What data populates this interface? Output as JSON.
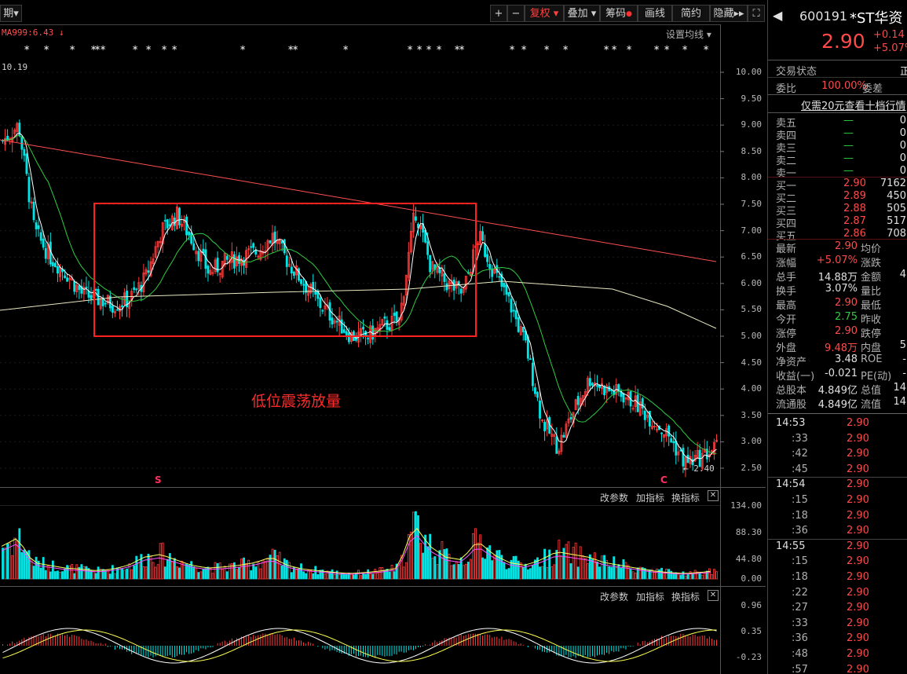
{
  "toolbar": {
    "period_label": "期",
    "plus": "+",
    "minus": "−",
    "fuquan": "复权",
    "diejia": "叠加",
    "chouma": "筹码",
    "huaxian": "画线",
    "jianyue": "简约",
    "yincang": "隐藏",
    "expand": "⛶"
  },
  "chart": {
    "ma_label": "MA999:6.43",
    "ma_arrow": "↓",
    "settings_label": "设置均线",
    "high_label": "10.19",
    "low_label": "2.40",
    "s_marker": "S",
    "c_marker": "C",
    "annotation": "低位震荡放量",
    "price_axis": [
      "10.00",
      "9.50",
      "9.00",
      "8.50",
      "8.00",
      "7.50",
      "7.00",
      "6.50",
      "6.00",
      "5.50",
      "5.00",
      "4.50",
      "4.00",
      "3.50",
      "3.00",
      "2.50"
    ],
    "volume_axis": [
      "134.00",
      "88.30",
      "44.80",
      "0.00"
    ],
    "macd_axis": [
      "0.96",
      "0.35",
      "-0.23"
    ],
    "vol_links": {
      "params": "改参数",
      "add": "加指标",
      "switch": "换指标"
    },
    "macd_links": {
      "params": "改参数",
      "add": "加指标",
      "switch": "换指标"
    },
    "colors": {
      "up": "#ff3b3b",
      "down": "#00e5e5",
      "ma_long": "#ff5050",
      "ma_slow": "#e8e8c0",
      "ma_mid": "#2ecc40",
      "ma_fast": "#ffffff",
      "box": "#ff2020"
    }
  },
  "chart_data": {
    "type": "candlestick",
    "price_range": [
      2.4,
      10.19
    ],
    "price_ticks": [
      10.0,
      9.5,
      9.0,
      8.5,
      8.0,
      7.5,
      7.0,
      6.5,
      6.0,
      5.5,
      5.0,
      4.5,
      4.0,
      3.5,
      3.0,
      2.5
    ],
    "volume_ticks": [
      134.0,
      88.3,
      44.8,
      0.0
    ],
    "macd_ticks": [
      0.96,
      0.35,
      -0.23
    ],
    "annotation": "低位震荡放量",
    "ma999_value": 6.43,
    "trend_close": [
      8.7,
      9.0,
      7.0,
      6.5,
      6.2,
      5.8,
      5.7,
      5.6,
      5.7,
      6.1,
      7.0,
      7.3,
      6.8,
      6.2,
      6.4,
      6.5,
      6.6,
      6.9,
      6.4,
      6.0,
      5.6,
      5.3,
      5.0,
      5.0,
      5.2,
      5.3,
      7.4,
      6.3,
      6.0,
      5.8,
      6.9,
      6.2,
      5.6,
      4.8,
      3.4,
      2.9,
      3.6,
      4.2,
      4.0,
      3.9,
      3.7,
      3.4,
      3.1,
      2.6,
      2.7,
      2.9
    ],
    "volume_profile": [
      60,
      75,
      30,
      25,
      20,
      18,
      15,
      18,
      25,
      40,
      45,
      35,
      25,
      20,
      22,
      25,
      30,
      40,
      25,
      18,
      15,
      12,
      10,
      12,
      15,
      20,
      100,
      60,
      40,
      35,
      70,
      45,
      30,
      25,
      35,
      50,
      45,
      40,
      30,
      25,
      20,
      15,
      12,
      10,
      12,
      15
    ]
  },
  "sidebar": {
    "code": "600191",
    "name": "*ST华资",
    "price": "2.90",
    "change": "+0.14",
    "change_pct": "+5.07%",
    "status_label": "交易状态",
    "status_val": "正",
    "weibi_label": "委比",
    "weibi_val": "100.00%",
    "weicha_label": "委差",
    "ad_text": "仅需20元查看十档行情",
    "sells": [
      {
        "label": "卖五",
        "price": "—",
        "vol": "0"
      },
      {
        "label": "卖四",
        "price": "—",
        "vol": "0"
      },
      {
        "label": "卖三",
        "price": "—",
        "vol": "0"
      },
      {
        "label": "卖二",
        "price": "—",
        "vol": "0"
      },
      {
        "label": "卖一",
        "price": "—",
        "vol": "0"
      }
    ],
    "buys": [
      {
        "label": "买一",
        "price": "2.90",
        "vol": "7162"
      },
      {
        "label": "买二",
        "price": "2.89",
        "vol": "450"
      },
      {
        "label": "买三",
        "price": "2.88",
        "vol": "505"
      },
      {
        "label": "买四",
        "price": "2.87",
        "vol": "517"
      },
      {
        "label": "买五",
        "price": "2.86",
        "vol": "708"
      }
    ],
    "stats": [
      {
        "l1": "最新",
        "v1": "2.90",
        "c1": "red",
        "l2": "均价",
        "v2": ""
      },
      {
        "l1": "涨幅",
        "v1": "+5.07%",
        "c1": "red",
        "l2": "涨跌",
        "v2": ""
      },
      {
        "l1": "总手",
        "v1": "14.88万",
        "c1": "white",
        "l2": "金额",
        "v2": "4"
      },
      {
        "l1": "换手",
        "v1": "3.07%",
        "c1": "white",
        "l2": "量比",
        "v2": ""
      },
      {
        "l1": "最高",
        "v1": "2.90",
        "c1": "red",
        "l2": "最低",
        "v2": ""
      },
      {
        "l1": "今开",
        "v1": "2.75",
        "c1": "green",
        "l2": "昨收",
        "v2": ""
      },
      {
        "l1": "涨停",
        "v1": "2.90",
        "c1": "red",
        "l2": "跌停",
        "v2": ""
      },
      {
        "l1": "外盘",
        "v1": "9.48万",
        "c1": "red",
        "l2": "内盘",
        "v2": "5"
      },
      {
        "l1": "净资产",
        "v1": "3.48",
        "c1": "white",
        "l2": "ROE",
        "v2": "-"
      },
      {
        "l1": "收益(一)",
        "v1": "-0.021",
        "c1": "white",
        "l2": "PE(动)",
        "v2": "-"
      },
      {
        "l1": "总股本",
        "v1": "4.849亿",
        "c1": "white",
        "l2": "总值",
        "v2": "14"
      },
      {
        "l1": "流通股",
        "v1": "4.849亿",
        "c1": "white",
        "l2": "流值",
        "v2": "14"
      }
    ],
    "ticks": [
      {
        "time": "14:53",
        "price": "2.90",
        "major": true
      },
      {
        "time": ":33",
        "price": "2.90",
        "major": false
      },
      {
        "time": ":42",
        "price": "2.90",
        "major": false
      },
      {
        "time": ":45",
        "price": "2.90",
        "major": false
      },
      {
        "time": "14:54",
        "price": "2.90",
        "major": true
      },
      {
        "time": ":15",
        "price": "2.90",
        "major": false
      },
      {
        "time": ":18",
        "price": "2.90",
        "major": false
      },
      {
        "time": ":36",
        "price": "2.90",
        "major": false
      },
      {
        "time": "14:55",
        "price": "2.90",
        "major": true
      },
      {
        "time": ":15",
        "price": "2.90",
        "major": false
      },
      {
        "time": ":18",
        "price": "2.90",
        "major": false
      },
      {
        "time": ":22",
        "price": "2.90",
        "major": false
      },
      {
        "time": ":27",
        "price": "2.90",
        "major": false
      },
      {
        "time": ":33",
        "price": "2.90",
        "major": false
      },
      {
        "time": ":36",
        "price": "2.90",
        "major": false
      },
      {
        "time": ":48",
        "price": "2.90",
        "major": false
      },
      {
        "time": ":57",
        "price": "2.90",
        "major": false
      }
    ]
  }
}
